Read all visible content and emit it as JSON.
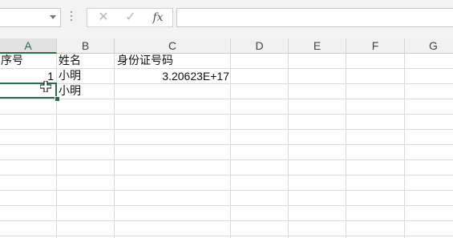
{
  "formula_bar": {
    "name_box_value": "",
    "cancel_icon": "✕",
    "enter_icon": "✓",
    "fx_label": "fx",
    "formula_value": ""
  },
  "columns": [
    "A",
    "B",
    "C",
    "D",
    "E",
    "F",
    "G"
  ],
  "selected_column": "A",
  "cells": {
    "a1": "序号",
    "b1": "姓名",
    "c1": "身份证号码",
    "a2": "1",
    "b2": "小明",
    "c2": "3.20623E+17",
    "b3": "小明"
  },
  "colors": {
    "accent": "#217346",
    "grid": "#dadada",
    "toolbar": "#f3f3f3"
  },
  "icons": {
    "cursor": "fill-cross-cursor-icon"
  }
}
